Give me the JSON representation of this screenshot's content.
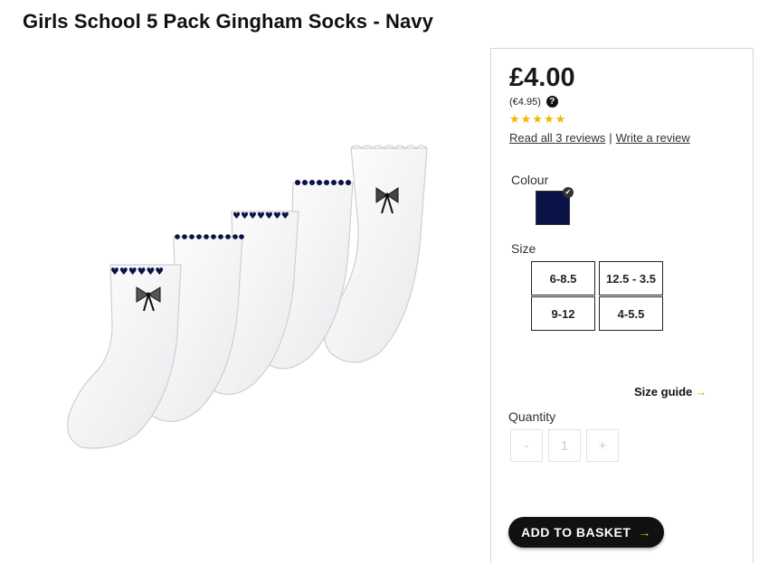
{
  "product": {
    "title": "Girls School 5 Pack Gingham Socks - Navy",
    "image_alt": "Five pack of white girls school socks with navy hearts and gingham bows"
  },
  "pricing": {
    "price": "£4.00",
    "euro_price": "(€4.95)",
    "help_icon": "?"
  },
  "rating": {
    "stars": "★★★★★",
    "star_color": "#f0b800",
    "read_reviews": "Read all 3 reviews",
    "separator": "|",
    "write_review": "Write a review"
  },
  "colour": {
    "label": "Colour",
    "selected_swatch_color": "#0b1246",
    "check_icon": "✔"
  },
  "size": {
    "label": "Size",
    "options": [
      "6-8.5",
      "12.5 - 3.5",
      "9-12",
      "4-5.5"
    ]
  },
  "size_guide": {
    "label": "Size guide",
    "arrow": "→"
  },
  "quantity": {
    "label": "Quantity",
    "minus": "-",
    "value": "1",
    "plus": "+"
  },
  "basket": {
    "label": "ADD TO BASKET",
    "arrow": "→"
  }
}
